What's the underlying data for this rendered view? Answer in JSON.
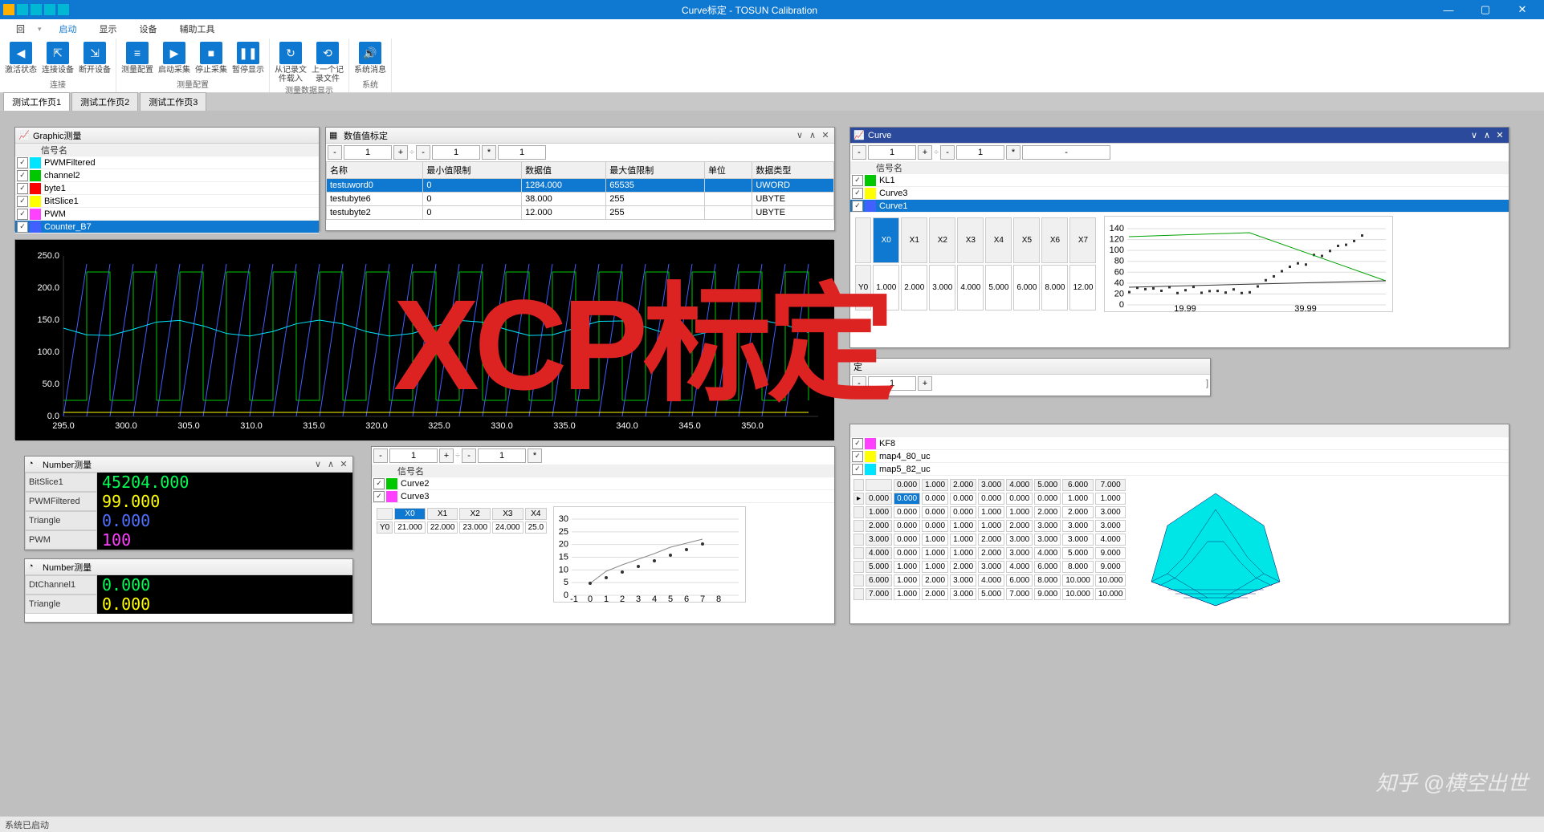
{
  "window": {
    "title": "Curve标定 - TOSUN Calibration"
  },
  "menus": {
    "items": [
      "回",
      "启动",
      "显示",
      "设备",
      "辅助工具"
    ]
  },
  "ribbon": {
    "groups": [
      {
        "label": "连接",
        "buttons": [
          {
            "icon": "◀",
            "label": "激活状态"
          },
          {
            "icon": "⇱",
            "label": "连接设备"
          },
          {
            "icon": "⇲",
            "label": "断开设备"
          }
        ]
      },
      {
        "label": "测量配置",
        "buttons": [
          {
            "icon": "≡",
            "label": "测量配置"
          },
          {
            "icon": "▶",
            "label": "启动采集"
          },
          {
            "icon": "■",
            "label": "停止采集"
          },
          {
            "icon": "❚❚",
            "label": "暂停显示"
          }
        ]
      },
      {
        "label": "测量数据显示",
        "buttons": [
          {
            "icon": "↻",
            "label": "从记录文件载入"
          },
          {
            "icon": "⟲",
            "label": "上一个记录文件"
          }
        ]
      },
      {
        "label": "系统",
        "buttons": [
          {
            "icon": "🔊",
            "label": "系统消息"
          }
        ]
      }
    ]
  },
  "tabs": [
    "测试工作页1",
    "测试工作页2",
    "测试工作页3"
  ],
  "graphic_panel": {
    "title": "Graphic测量",
    "header": "信号名",
    "signals": [
      {
        "color": "#00e5ff",
        "name": "PWMFiltered"
      },
      {
        "color": "#00c800",
        "name": "channel2"
      },
      {
        "color": "#ff0000",
        "name": "byte1"
      },
      {
        "color": "#ffff00",
        "name": "BitSlice1"
      },
      {
        "color": "#ff40ff",
        "name": "PWM"
      },
      {
        "color": "#4060ff",
        "name": "Counter_B7",
        "selected": true
      }
    ]
  },
  "chart_data": {
    "type": "line",
    "title": "Graphic测量",
    "ylim": [
      0,
      250
    ],
    "yticks": [
      0,
      50,
      100,
      150,
      200,
      250
    ],
    "xticks": [
      295,
      300,
      305,
      310,
      315,
      320,
      325,
      330,
      335,
      340,
      345,
      350
    ],
    "series_hint": "multiple sawtooth/square waveforms overlaid"
  },
  "value_cal": {
    "title": "数值值标定",
    "spinners": [
      "1",
      "1",
      "1"
    ],
    "cols": [
      "名称",
      "最小值限制",
      "数据值",
      "最大值限制",
      "单位",
      "数据类型"
    ],
    "rows": [
      {
        "sel": true,
        "c": [
          "testuword0",
          "0",
          "1284.000",
          "65535",
          "",
          "UWORD"
        ]
      },
      {
        "sel": false,
        "c": [
          "testubyte6",
          "0",
          "38.000",
          "255",
          "",
          "UBYTE"
        ]
      },
      {
        "sel": false,
        "c": [
          "testubyte2",
          "0",
          "12.000",
          "255",
          "",
          "UBYTE"
        ]
      }
    ]
  },
  "number_m1": {
    "title": "Number测量",
    "rows": [
      {
        "label": "BitSlice1",
        "value": "45204.000",
        "color": "#00ff55"
      },
      {
        "label": "PWMFiltered",
        "value": "99.000",
        "color": "#ffff00"
      },
      {
        "label": "Triangle",
        "value": "0.000",
        "color": "#5070ff"
      },
      {
        "label": "PWM",
        "value": "100",
        "color": "#ff40ff"
      }
    ]
  },
  "number_m2": {
    "title": "Number测量",
    "rows": [
      {
        "label": "DtChannel1",
        "value": "0.000",
        "color": "#00ff55"
      },
      {
        "label": "Triangle",
        "value": "0.000",
        "color": "#ffff00"
      }
    ]
  },
  "curve_small": {
    "spinners": [
      "1",
      "1"
    ],
    "header": "信号名",
    "signals": [
      {
        "color": "#00c800",
        "name": "Curve2"
      },
      {
        "color": "#ff40ff",
        "name": "Curve3"
      }
    ],
    "xhead": [
      "X0",
      "X1",
      "X2",
      "X3",
      "X4"
    ],
    "yrow": [
      "21.000",
      "22.000",
      "23.000",
      "24.000",
      "25.0"
    ],
    "ylabel": "Y0",
    "mini_chart": {
      "type": "line",
      "x": [
        -1,
        0,
        1,
        2,
        3,
        4,
        5,
        6,
        7,
        8
      ],
      "ylim": [
        0,
        30
      ],
      "yticks": [
        0,
        5,
        10,
        15,
        20,
        25,
        30
      ]
    }
  },
  "curve_panel": {
    "title": "Curve",
    "spinners": [
      "1",
      "1",
      "-"
    ],
    "header": "信号名",
    "signals": [
      {
        "color": "#00c800",
        "name": "KL1"
      },
      {
        "color": "#ffff00",
        "name": "Curve3"
      },
      {
        "color": "#4060ff",
        "name": "Curve1",
        "selected": true
      }
    ],
    "xhead": [
      "X0",
      "X1",
      "X2",
      "X3",
      "X4",
      "X5",
      "X6",
      "X7"
    ],
    "xvals": [
      "1.000",
      "2.000",
      "3.000",
      "4.000",
      "5.000",
      "6.000",
      "8.000",
      "12.00"
    ],
    "ylabel": "Y0",
    "mini_chart": {
      "type": "scatter",
      "ylim": [
        0,
        140
      ],
      "yticks": [
        0,
        20,
        40,
        60,
        80,
        100,
        120,
        140
      ],
      "xticks": [
        "19.99",
        "39.99"
      ]
    }
  },
  "middle_frag": {
    "spin": "1",
    "label_suffix": "定",
    "row_hint": "]"
  },
  "map_panel": {
    "signals": [
      {
        "color": "#ff40ff",
        "name": "KF8"
      },
      {
        "color": "#ffff00",
        "name": "map4_80_uc"
      },
      {
        "color": "#00e5ff",
        "name": "map5_82_uc"
      }
    ],
    "col_head": [
      "0.000",
      "1.000",
      "2.000",
      "3.000",
      "4.000",
      "5.000",
      "6.000",
      "7.000"
    ],
    "row_head": [
      "0.000",
      "1.000",
      "2.000",
      "3.000",
      "4.000",
      "5.000",
      "6.000",
      "7.000"
    ],
    "grid": [
      [
        "0.000",
        "0.000",
        "0.000",
        "0.000",
        "0.000",
        "0.000",
        "1.000",
        "1.000"
      ],
      [
        "0.000",
        "0.000",
        "0.000",
        "1.000",
        "1.000",
        "2.000",
        "2.000",
        "3.000"
      ],
      [
        "0.000",
        "0.000",
        "1.000",
        "1.000",
        "2.000",
        "3.000",
        "3.000",
        "3.000"
      ],
      [
        "0.000",
        "1.000",
        "1.000",
        "2.000",
        "3.000",
        "3.000",
        "3.000",
        "4.000"
      ],
      [
        "0.000",
        "1.000",
        "1.000",
        "2.000",
        "3.000",
        "4.000",
        "5.000",
        "9.000"
      ],
      [
        "1.000",
        "1.000",
        "2.000",
        "3.000",
        "4.000",
        "6.000",
        "8.000",
        "9.000"
      ],
      [
        "1.000",
        "2.000",
        "3.000",
        "4.000",
        "6.000",
        "8.000",
        "10.000",
        "10.000"
      ],
      [
        "1.000",
        "2.000",
        "3.000",
        "5.000",
        "7.000",
        "9.000",
        "10.000",
        "10.000"
      ]
    ]
  },
  "overlay": "XCP标定",
  "watermark": "知乎 @横空出世",
  "status": "系统已启动"
}
